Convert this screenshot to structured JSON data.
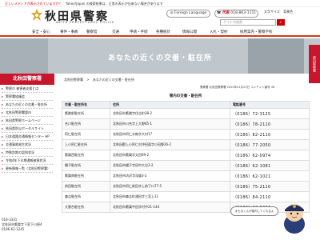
{
  "notice": {
    "warn": "正しいメディアが表示されていますか？",
    "text": "Yahoo!Japan の検索結果は、正常の表示が出来ない場合があります"
  },
  "header": {
    "title": "秋田県警察",
    "subtitle": "AKITA PREFECTURAL POLICE",
    "lang_button": "Foreign Language",
    "phone_label": "代表",
    "phone_number": "018-863-1111",
    "util_links": [
      "文字サイズ",
      "背景色"
    ],
    "search_placeholder": "サイト内検索",
    "search_icon": "search-icon"
  },
  "nav": [
    "安全・安心",
    "事件・事故",
    "警察官",
    "交通",
    "申請・手続",
    "各種統計",
    "情報公開",
    "入札・契約",
    "採用案内・警察学校"
  ],
  "hero": {
    "title": "あなたの近くの交番・駐在所"
  },
  "right_tab": "県内警察署",
  "sidebar": {
    "heading": "北秋田警察署",
    "items": [
      "警察の 被害者支援とは",
      "警察署協議会",
      "あなたの近くの交番・駐在所",
      "北秋田警察署管内",
      "秋田県警察ホームページ",
      "秋田県防災ポータルサイト",
      "日本道路交通情報センター HP",
      "交通事故発生状況",
      "特殊詐欺の認知状況",
      "令和4年下半期通報被害状況",
      "更新情報一覧（北秋田警察署）"
    ],
    "footer_tel": "018-3331",
    "footer_addr": "北秋田市鷹巣字下家下川原4",
    "footer_fax": "0186-62-1245"
  },
  "breadcrumb": [
    "北秋田警察署",
    "あなたの近くの交番・駐在所"
  ],
  "meta": "警察署 北秋田警察署  2020年01月23日  コンテンツ番号 36",
  "table": {
    "caption": "管内の交番・駐在所",
    "headers": [
      "交番・駐在所名",
      "住所",
      "電話番号"
    ],
    "rows": [
      [
        "鷹巣前駐在所",
        "北秋田市鷹巣字住吉町38-2",
        "（0186）72-3125"
      ],
      [
        "合川駐在所",
        "北秋田市川合字上大野85-1",
        "（0186）78-2110"
      ],
      [
        "阿仁駐在所",
        "北秋田市阿仁水無字大村17",
        "（0186）82-2110"
      ],
      [
        "上小阿仁駐在所",
        "北秋田郡上小阿仁村沖田面字小田野26-2",
        "（0186）77-2050"
      ],
      [
        "鷹巣西駐在所",
        "北秋田市鷹巣字太田69-2",
        "（0186）62-0974"
      ],
      [
        "綴子駐在所",
        "北秋田市綴子字田中大谷3-2",
        "（0186）62-1081"
      ],
      [
        "鷹巣南駐在所",
        "北秋田市坊沢字深盛3-2",
        "（0186）62-1021"
      ],
      [
        "前田駐在所",
        "北秋田市阿仁前田字上前下口77-5",
        "（0186）75-2110"
      ],
      [
        "森吉駐在所",
        "北秋田市森吉町浦田字三宮上11",
        "（0186）84-2110"
      ],
      [
        "大野台駐在所",
        "北秋田市鷹巣中田字村中21-144",
        "（0186）62-5006"
      ]
    ]
  },
  "mascot_bubble": "まもるくんが案内してくれるよ",
  "colors": {
    "accent": "#c8162c",
    "nav_border": "#d43a1a"
  }
}
